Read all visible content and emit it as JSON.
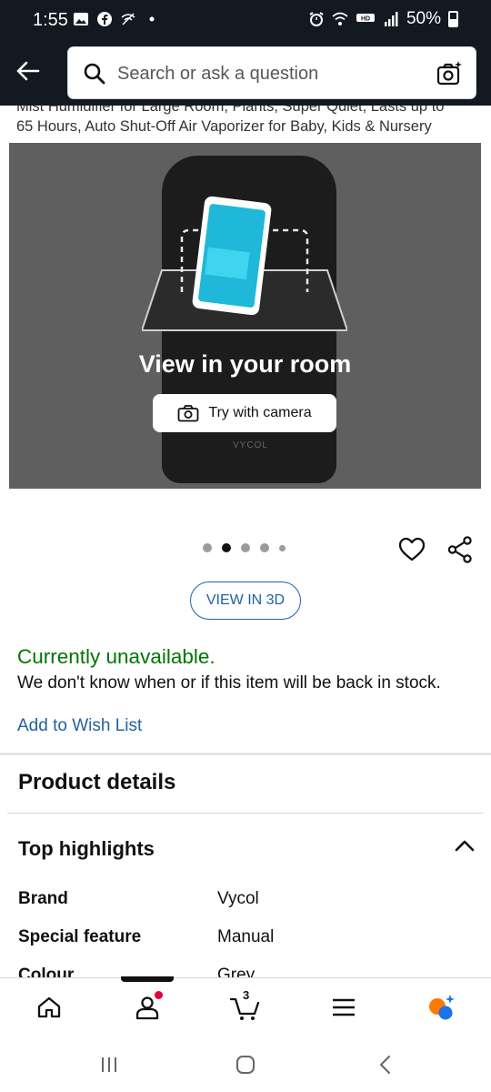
{
  "status_bar": {
    "time": "1:55",
    "battery": "50%"
  },
  "header": {
    "search_placeholder": "Search or ask a question"
  },
  "product": {
    "title_line1": "Mist Humidifier for Large Room, Plants, Super Quiet, Lasts up to",
    "title_line2": "65 Hours, Auto Shut-Off Air Vaporizer for Baby, Kids & Nursery",
    "brand_on_device": "VYCOL"
  },
  "gallery": {
    "view_in_room": "View in your room",
    "try_camera": "Try with camera",
    "dots_total": 5,
    "active_dot": 2
  },
  "actions": {
    "view3d": "VIEW IN 3D"
  },
  "availability": {
    "status": "Currently unavailable.",
    "note": "We don't know when or if this item will be back in stock.",
    "wishlist": "Add to Wish List"
  },
  "details": {
    "section_title": "Product details",
    "highlights_title": "Top highlights",
    "specs": [
      {
        "key": "Brand",
        "value": "Vycol"
      },
      {
        "key": "Special feature",
        "value": "Manual"
      },
      {
        "key": "Colour",
        "value": "Grey"
      }
    ]
  },
  "bottom_nav": {
    "cart_count": "3",
    "items": [
      "home-icon",
      "account-icon",
      "cart-icon",
      "menu-icon",
      "rufus-icon"
    ]
  },
  "colors": {
    "header_bg": "#131921",
    "link": "#2162a1",
    "available_green": "#007600",
    "notification": "#e4003a"
  }
}
